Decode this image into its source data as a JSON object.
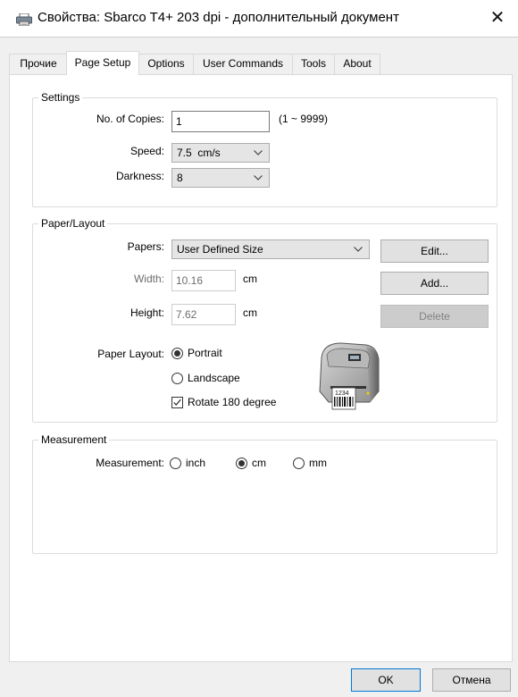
{
  "window": {
    "title": "Свойства: Sbarco T4+ 203 dpi - дополнительный документ",
    "icon": "printer-icon",
    "close_glyph": "✕"
  },
  "tabs": [
    {
      "label": "Прочие",
      "active": false
    },
    {
      "label": "Page Setup",
      "active": true
    },
    {
      "label": "Options",
      "active": false
    },
    {
      "label": "User Commands",
      "active": false
    },
    {
      "label": "Tools",
      "active": false
    },
    {
      "label": "About",
      "active": false
    }
  ],
  "settings": {
    "legend": "Settings",
    "copies_label": "No. of Copies:",
    "copies_value": "1",
    "copies_range": "(1 ~ 9999)",
    "speed_label": "Speed:",
    "speed_value": "7.5  cm/s",
    "darkness_label": "Darkness:",
    "darkness_value": "8"
  },
  "paper_layout": {
    "legend": "Paper/Layout",
    "papers_label": "Papers:",
    "papers_value": "User Defined Size",
    "edit_button": "Edit...",
    "add_button": "Add...",
    "delete_button": "Delete",
    "width_label": "Width:",
    "width_value": "10.16",
    "width_unit": "cm",
    "height_label": "Height:",
    "height_value": "7.62",
    "height_unit": "cm",
    "layout_label": "Paper Layout:",
    "portrait_label": "Portrait",
    "portrait_selected": true,
    "landscape_label": "Landscape",
    "landscape_selected": false,
    "rotate_label": "Rotate 180 degree",
    "rotate_checked": true,
    "label_text": "1234"
  },
  "measurement": {
    "legend": "Measurement",
    "label": "Measurement:",
    "options": [
      {
        "label": "inch",
        "selected": false
      },
      {
        "label": "cm",
        "selected": true
      },
      {
        "label": "mm",
        "selected": false
      }
    ]
  },
  "footer": {
    "ok_button": "OK",
    "cancel_button": "Отмена"
  }
}
